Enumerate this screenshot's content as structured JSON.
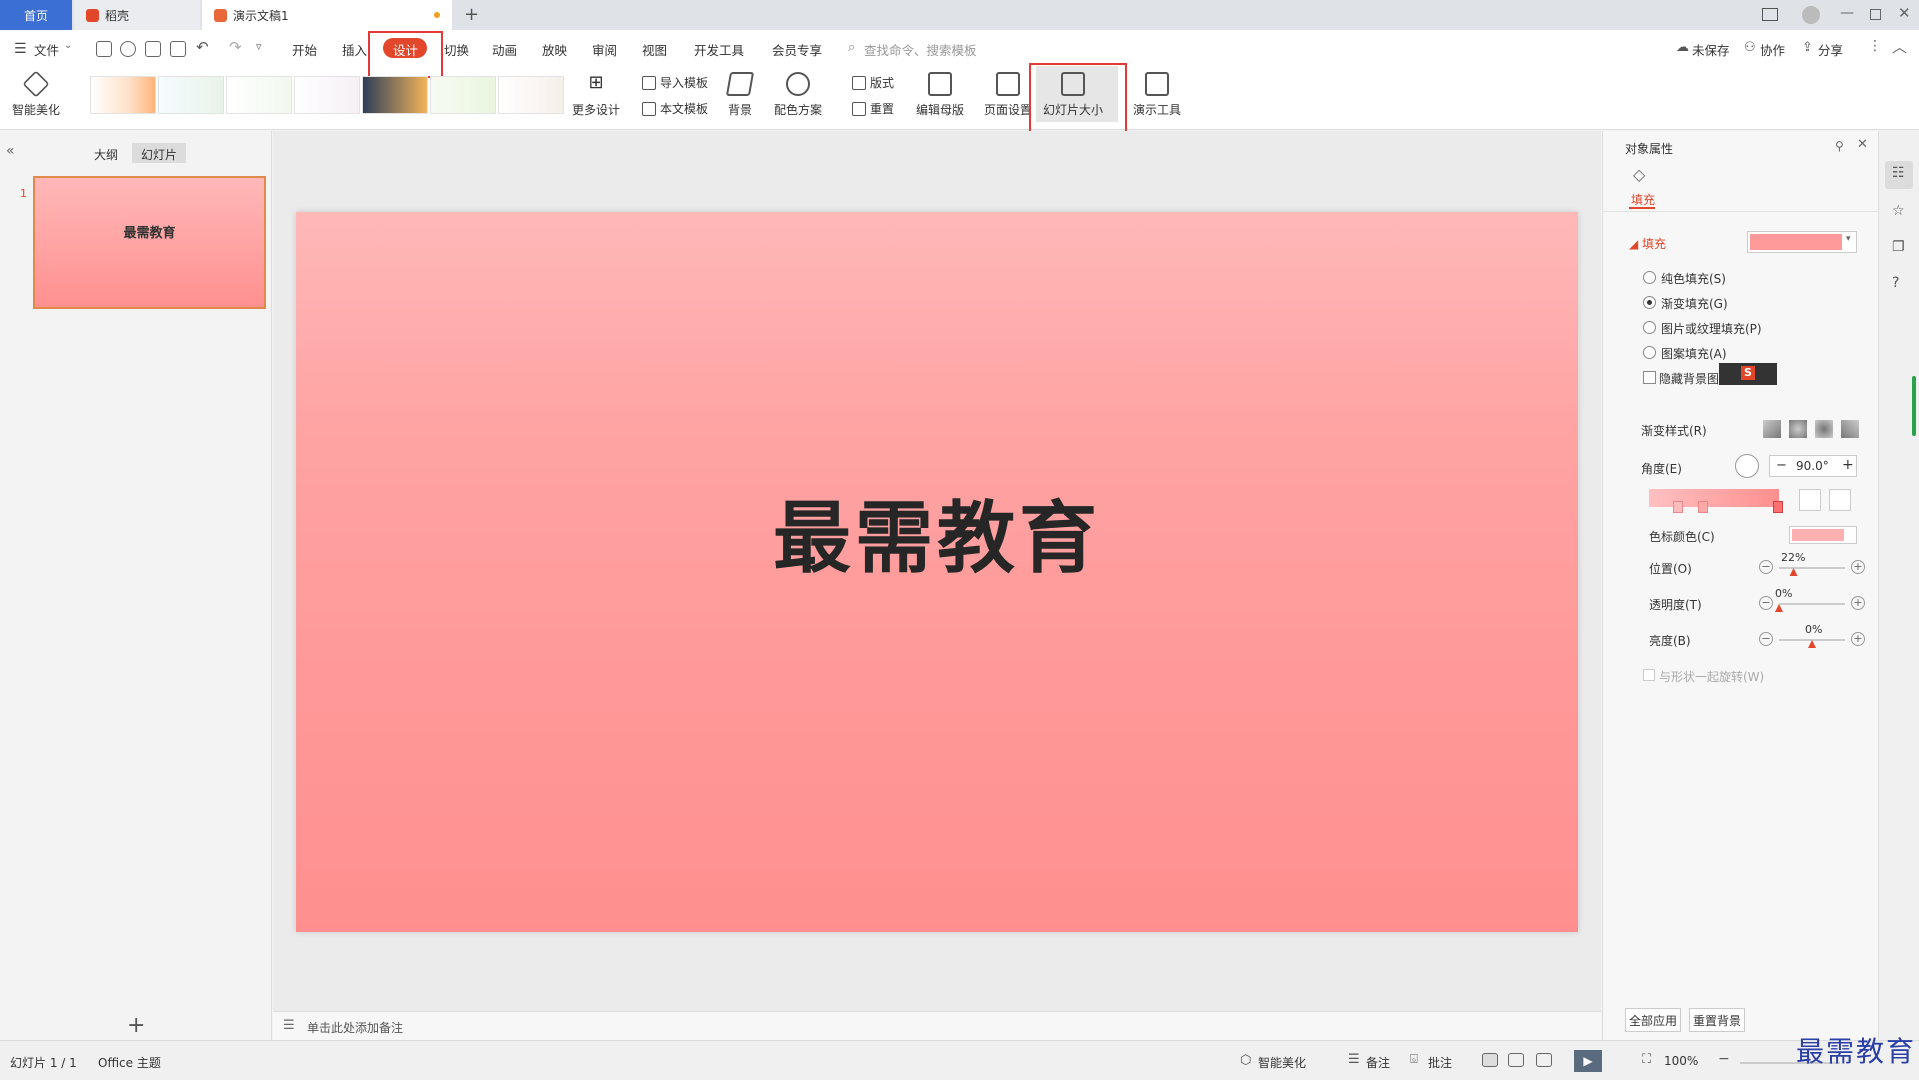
{
  "tabs": {
    "home": "首页",
    "daoke": "稻壳",
    "doc": "演示文稿1"
  },
  "menu": {
    "file": "文件",
    "start": "开始",
    "insert": "插入",
    "design": "设计",
    "transition": "切换",
    "animation": "动画",
    "slideshow": "放映",
    "review": "审阅",
    "view": "视图",
    "devtools": "开发工具",
    "member": "会员专享",
    "search_placeholder": "查找命令、搜索模板",
    "unsaved": "未保存",
    "collab": "协作",
    "share": "分享"
  },
  "ribbon": {
    "smart_beautify": "智能美化",
    "more_design": "更多设计",
    "import_template": "导入模板",
    "this_template": "本文模板",
    "background": "背景",
    "color_scheme": "配色方案",
    "layout": "版式",
    "reset": "重置",
    "edit_master": "编辑母版",
    "page_setup": "页面设置",
    "slide_size": "幻灯片大小",
    "present_tools": "演示工具"
  },
  "left": {
    "outline": "大纲",
    "slides": "幻灯片",
    "slide_num": "1",
    "thumb_title": "最需教育"
  },
  "slide": {
    "title": "最需教育"
  },
  "notes": {
    "placeholder": "单击此处添加备注"
  },
  "panel": {
    "title": "对象属性",
    "tab_fill": "填充",
    "section_fill": "填充",
    "solid": "纯色填充(S)",
    "gradient": "渐变填充(G)",
    "picture": "图片或纹理填充(P)",
    "pattern": "图案填充(A)",
    "hide_bg": "隐藏背景图形",
    "gradient_style": "渐变样式(R)",
    "angle": "角度(E)",
    "angle_value": "90.0°",
    "stop_color": "色标颜色(C)",
    "position": "位置(O)",
    "position_value": "22%",
    "position_level": 0.22,
    "transparency": "透明度(T)",
    "transparency_value": "0%",
    "transparency_level": 0,
    "brightness": "亮度(B)",
    "brightness_value": "0%",
    "brightness_level": 0.5,
    "rotate_with_shape": "与形状一起旋转(W)",
    "apply_all": "全部应用",
    "reset_bg": "重置背景",
    "fill_color": "#ff9a9a"
  },
  "status": {
    "slide_info": "幻灯片 1 / 1",
    "theme": "Office 主题",
    "smart": "智能美化",
    "notes": "备注",
    "comments": "批注",
    "zoom": "100%"
  },
  "watermark": "最需教育",
  "colors": {
    "accent": "#e2472c",
    "highlight": "#e53935",
    "slide_top": "#ffb8b8",
    "slide_bottom": "#ff8f8f"
  }
}
